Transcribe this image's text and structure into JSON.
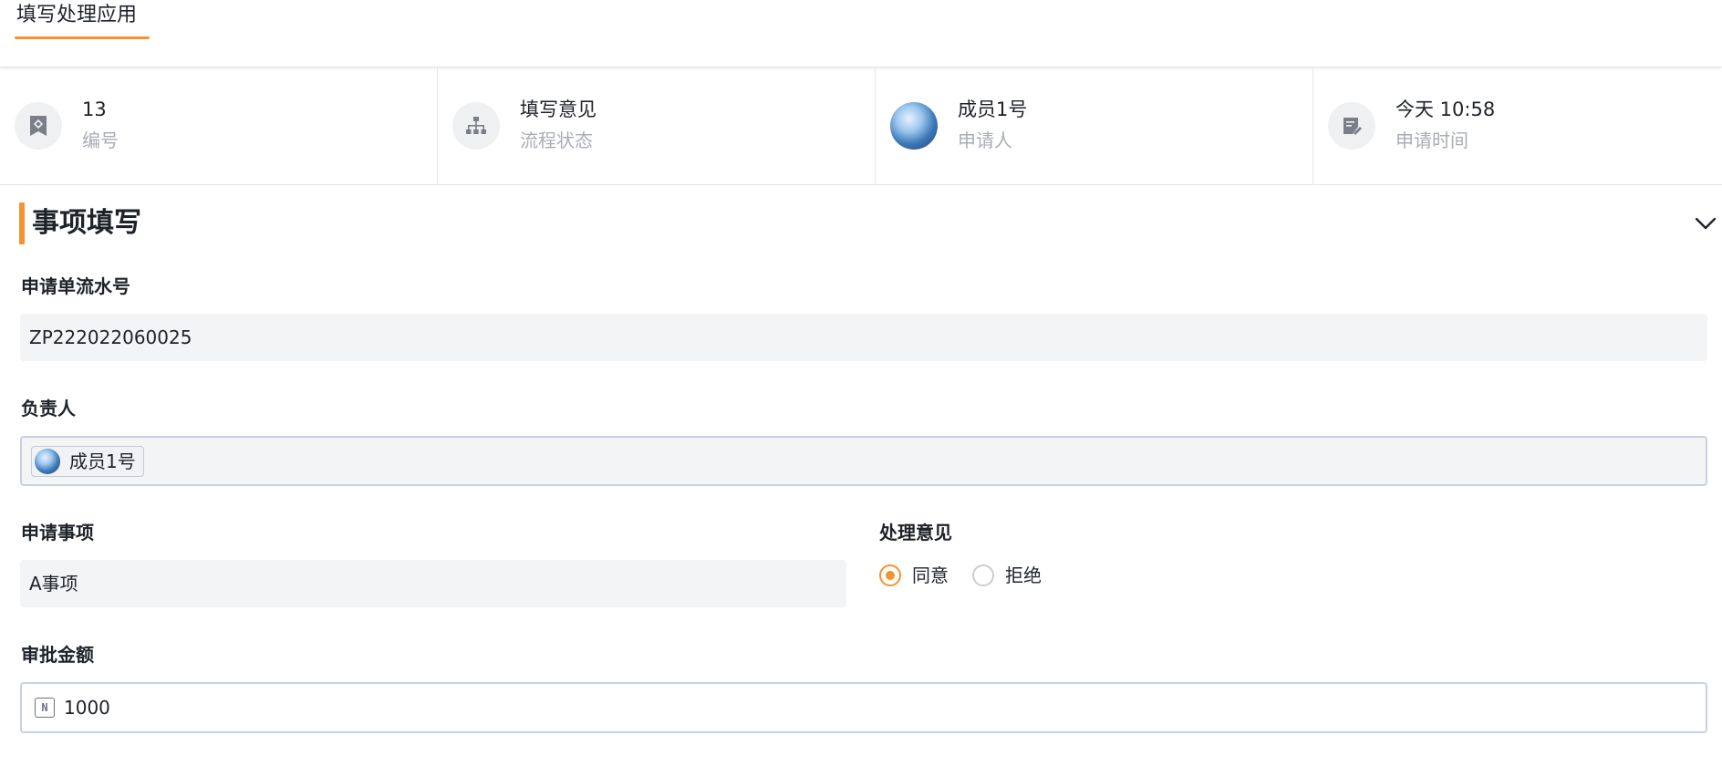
{
  "tab": {
    "label": "填写处理应用",
    "accent": "#f5932f"
  },
  "info": {
    "number": {
      "value": "13",
      "label": "编号"
    },
    "status": {
      "value": "填写意见",
      "label": "流程状态"
    },
    "applicant": {
      "value": "成员1号",
      "label": "申请人"
    },
    "time": {
      "value": "今天 10:58",
      "label": "申请时间"
    }
  },
  "section": {
    "title": "事项填写"
  },
  "fields": {
    "serial": {
      "label": "申请单流水号",
      "value": "ZP222022060025"
    },
    "owner": {
      "label": "负责人",
      "member": "成员1号"
    },
    "matter": {
      "label": "申请事项",
      "value": "A事项"
    },
    "opinion": {
      "label": "处理意见",
      "options": [
        "同意",
        "拒绝"
      ],
      "selected": "同意"
    },
    "amount": {
      "label": "审批金额",
      "value": "1000"
    }
  }
}
